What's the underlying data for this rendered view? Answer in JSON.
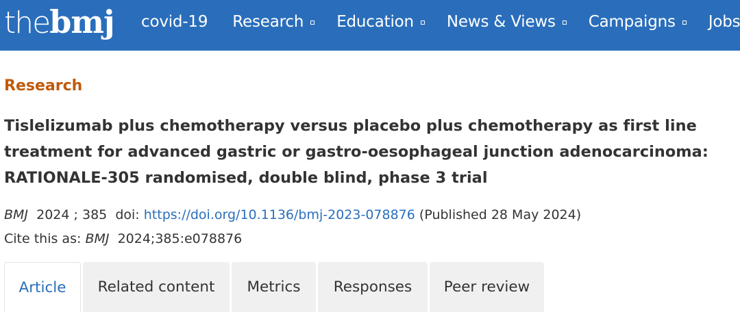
{
  "header": {
    "logo_the": "the",
    "logo_bmj": "bmj",
    "nav": [
      {
        "label": "covid-19",
        "has_dropdown": false
      },
      {
        "label": "Research",
        "has_dropdown": true
      },
      {
        "label": "Education",
        "has_dropdown": true
      },
      {
        "label": "News & Views",
        "has_dropdown": true
      },
      {
        "label": "Campaigns",
        "has_dropdown": true
      },
      {
        "label": "Jobs",
        "has_dropdown": true
      }
    ]
  },
  "article": {
    "section": "Research",
    "title": "Tislelizumab plus chemotherapy versus placebo plus chemotherapy as first line treatment for advanced gastric or gastro-oesophageal junction adenocarcinoma: RATIONALE-305 randomised, double blind, phase 3 trial",
    "journal": "BMJ",
    "year": "2024",
    "volume": "385",
    "doi_label": "doi:",
    "doi_url": "https://doi.org/10.1136/bmj-2023-078876",
    "published": "(Published 28 May 2024)",
    "cite_label": "Cite this as:",
    "cite_value": "2024;385:e078876"
  },
  "tabs": [
    {
      "label": "Article",
      "active": true
    },
    {
      "label": "Related content",
      "active": false
    },
    {
      "label": "Metrics",
      "active": false
    },
    {
      "label": "Responses",
      "active": false
    },
    {
      "label": "Peer review",
      "active": false
    }
  ],
  "colors": {
    "brand_blue": "#2a6ebb",
    "section_orange": "#c05a0d",
    "text": "#333333",
    "tab_inactive_bg": "#f0f0f0"
  }
}
